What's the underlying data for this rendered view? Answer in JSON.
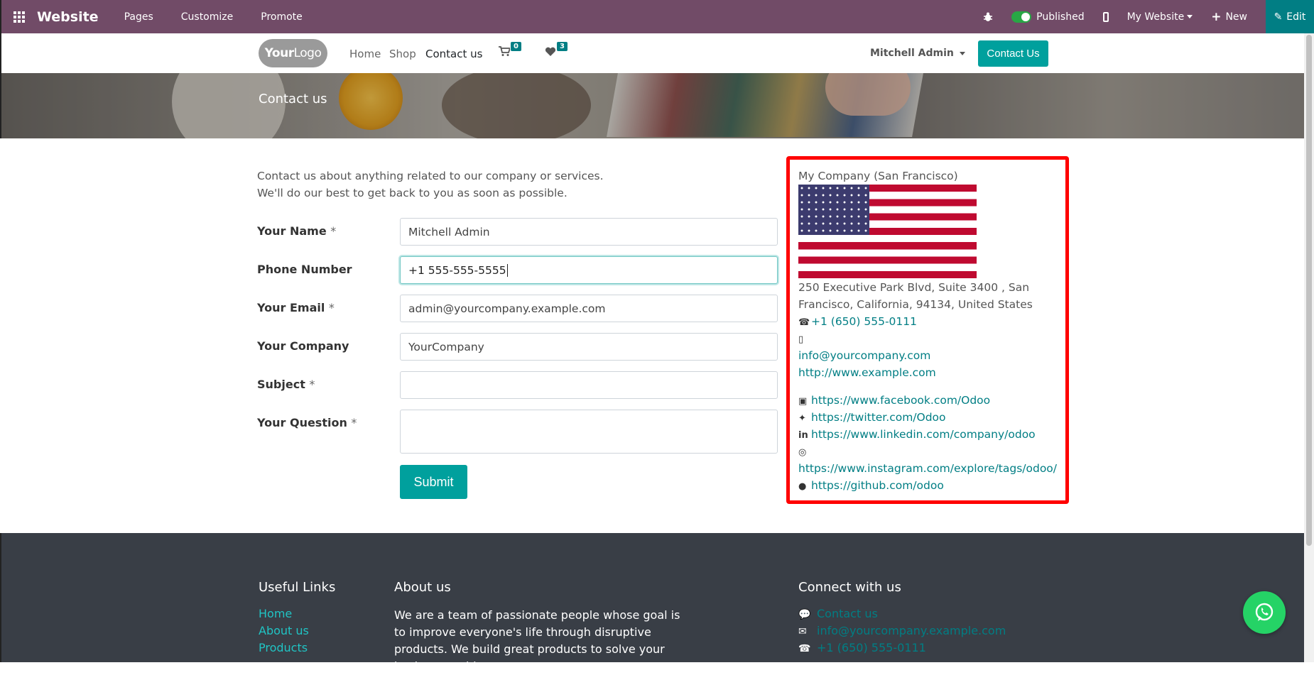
{
  "topbar": {
    "brand": "Website",
    "menus": [
      "Pages",
      "Customize",
      "Promote"
    ],
    "published_label": "Published",
    "website_select": "My Website",
    "new_label": "New",
    "edit_label": "Edit"
  },
  "nav": {
    "logo": {
      "part1": "Your",
      "part2": "Logo"
    },
    "links": [
      "Home",
      "Shop",
      "Contact us"
    ],
    "cart_count": "0",
    "wishlist_count": "3",
    "user": "Mitchell Admin",
    "cta": "Contact Us"
  },
  "banner": {
    "title": "Contact us"
  },
  "intro": {
    "line1": "Contact us about anything related to our company or services.",
    "line2": "We'll do our best to get back to you as soon as possible."
  },
  "form": {
    "fields": [
      {
        "label": "Your Name",
        "required": "*",
        "value": "Mitchell Admin"
      },
      {
        "label": "Phone Number",
        "required": "",
        "value": "+1 555-555-5555"
      },
      {
        "label": "Your Email",
        "required": "*",
        "value": "admin@yourcompany.example.com"
      },
      {
        "label": "Your Company",
        "required": "",
        "value": "YourCompany"
      },
      {
        "label": "Subject",
        "required": "*",
        "value": ""
      },
      {
        "label": "Your Question",
        "required": "*",
        "value": ""
      }
    ],
    "submit": "Submit"
  },
  "address": {
    "company": "My Company (San Francisco)",
    "street_line1": "250 Executive Park Blvd, Suite 3400 , San",
    "street_line2": "Francisco, California, 94134, United States",
    "phone": "+1 (650) 555-0111",
    "email": "info@yourcompany.com",
    "website": "http://www.example.com",
    "facebook": "https://www.facebook.com/Odoo",
    "twitter": "https://twitter.com/Odoo",
    "linkedin": "https://www.linkedin.com/company/odoo",
    "instagram": "https://www.instagram.com/explore/tags/odoo/",
    "github": "https://github.com/odoo",
    "highlight_color": "#ff0000"
  },
  "footer": {
    "useful_links_title": "Useful Links",
    "useful_links": [
      "Home",
      "About us",
      "Products"
    ],
    "about_title": "About us",
    "about_text": "We are a team of passionate people whose goal is to improve everyone's life through disruptive products. We build great products to solve your business problems.",
    "connect_title": "Connect with us",
    "connect_contact": "Contact us",
    "connect_email": "info@yourcompany.example.com",
    "connect_phone": "+1 (650) 555-0111"
  },
  "colors": {
    "topbar": "#714b67",
    "accent": "#00a09d",
    "link": "#017e84",
    "footer": "#393e46",
    "whatsapp": "#25d366"
  }
}
